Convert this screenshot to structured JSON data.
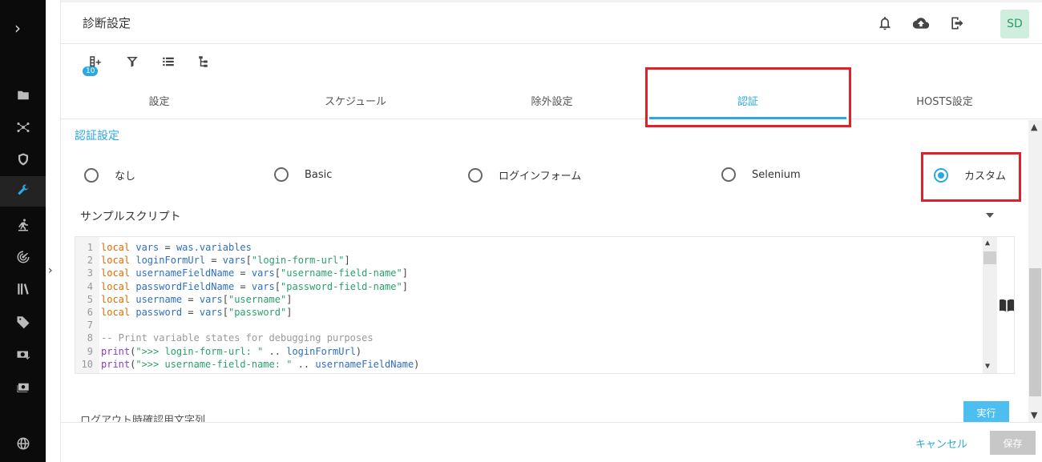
{
  "header": {
    "title": "診断設定",
    "avatar": "SD",
    "icons": [
      "bell-icon",
      "cloud-upload-icon",
      "logout-icon"
    ]
  },
  "toolbar": {
    "badge": "10",
    "icons": [
      "add-list-icon",
      "filter-icon",
      "list-icon",
      "tree-icon"
    ]
  },
  "tabs": [
    {
      "label": "設定"
    },
    {
      "label": "スケジュール"
    },
    {
      "label": "除外設定"
    },
    {
      "label": "認証",
      "active": true
    },
    {
      "label": "HOSTS設定"
    }
  ],
  "auth": {
    "section_title": "認証設定",
    "options": [
      {
        "label": "なし"
      },
      {
        "label": "Basic"
      },
      {
        "label": "ログインフォーム"
      },
      {
        "label": "Selenium"
      },
      {
        "label": "カスタム",
        "checked": true
      }
    ],
    "sample_label": "サンプルスクリプト"
  },
  "code_lines": [
    "local vars = was.variables",
    "local loginFormUrl = vars[\"login-form-url\"]",
    "local usernameFieldName = vars[\"username-field-name\"]",
    "local passwordFieldName = vars[\"password-field-name\"]",
    "local username = vars[\"username\"]",
    "local password = vars[\"password\"]",
    "",
    "-- Print variable states for debugging purposes",
    "print(\">>> login-form-url: \" .. loginFormUrl)",
    "print(\">>> username-field-name: \" .. usernameFieldName)"
  ],
  "logout_label": "ログアウト時確認用文字列",
  "run_label": "実行",
  "footer": {
    "cancel_label": "キャンセル",
    "save_label": "保存"
  },
  "colors": {
    "accent": "#29a9e0",
    "highlight": "#e0212b"
  }
}
